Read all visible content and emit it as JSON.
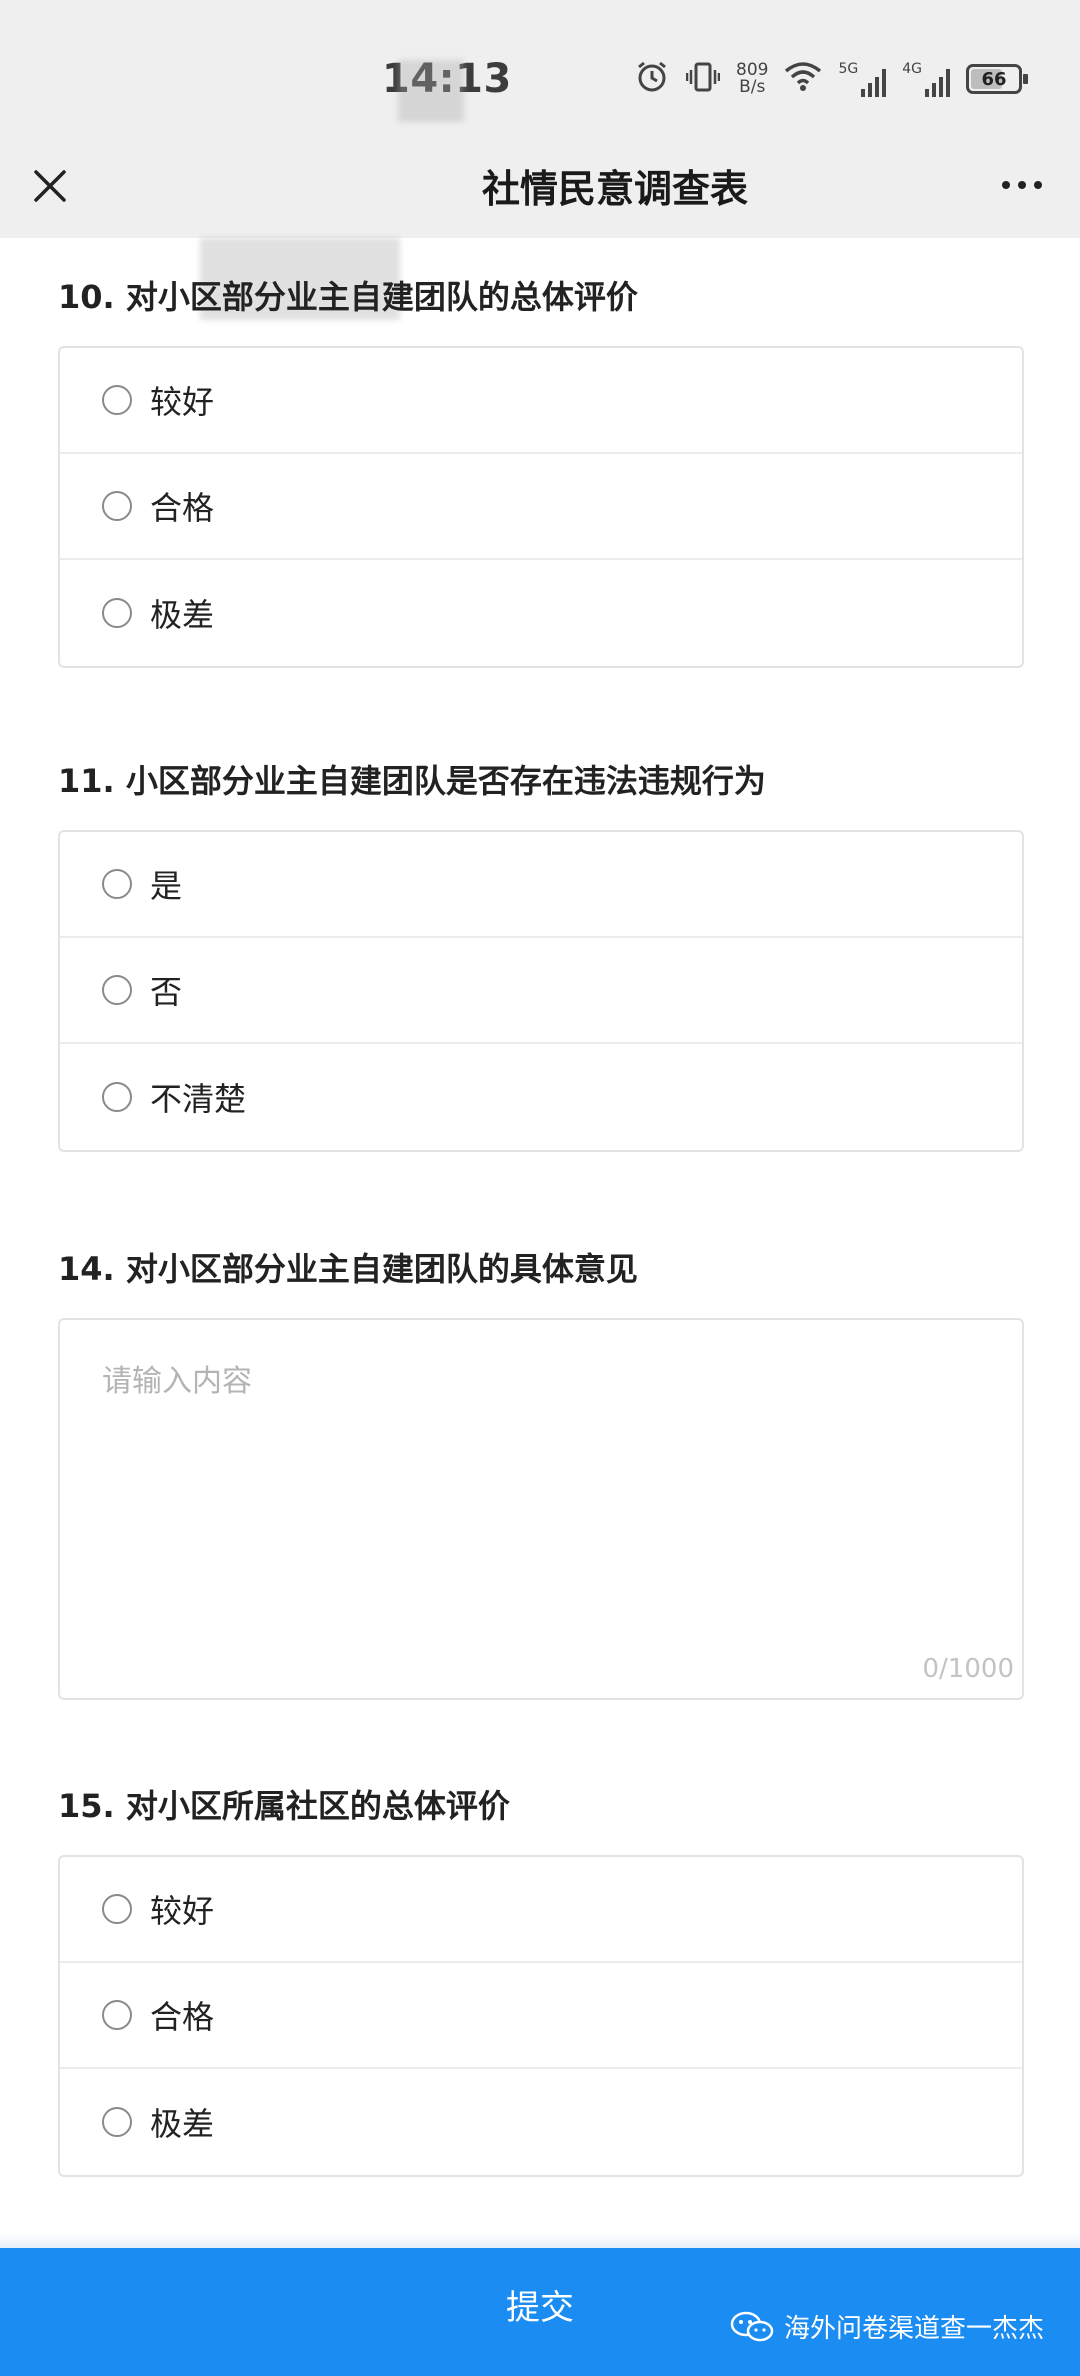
{
  "status_bar": {
    "time": "14:13",
    "net_speed_value": "809",
    "net_speed_unit": "B/s",
    "signal_1_label": "5G",
    "signal_2_label": "4G",
    "battery": "66"
  },
  "title_bar": {
    "title": "社情民意调查表"
  },
  "questions": [
    {
      "title": "10. 对小区部分业主自建团队的总体评价",
      "options": [
        "较好",
        "合格",
        "极差"
      ]
    },
    {
      "title": "11. 小区部分业主自建团队是否存在违法违规行为",
      "options": [
        "是",
        "否",
        "不清楚"
      ]
    },
    {
      "title": "14. 对小区部分业主自建团队的具体意见",
      "placeholder": "请输入内容",
      "counter": "0/1000"
    },
    {
      "title": "15. 对小区所属社区的总体评价",
      "options": [
        "较好",
        "合格",
        "极差"
      ]
    }
  ],
  "submit": {
    "label": "提交"
  },
  "watermark": {
    "text": "海外问卷渠道查一杰杰"
  },
  "colors": {
    "primary": "#1a8cf2",
    "topbar_bg": "#efefef"
  }
}
